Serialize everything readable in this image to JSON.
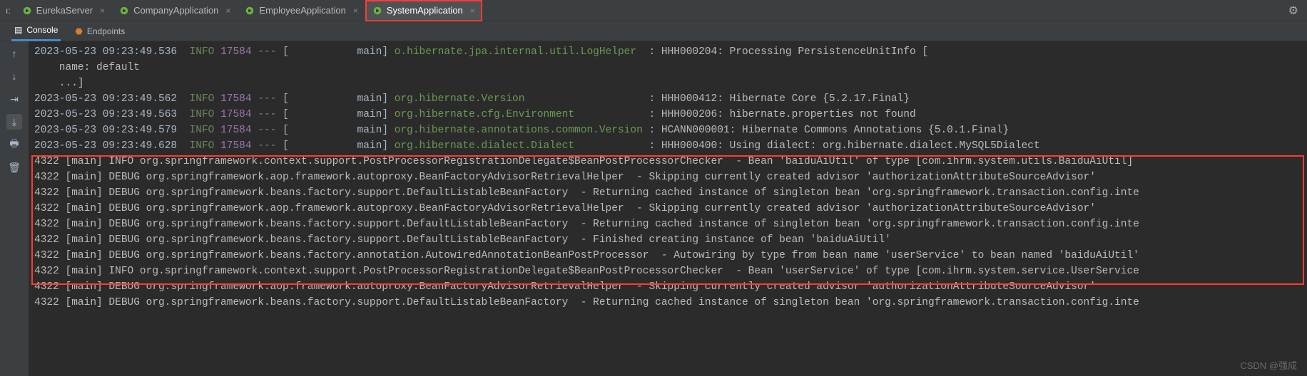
{
  "tabBar": {
    "leftLabel": "ı:",
    "tabs": [
      {
        "label": "EurekaServer",
        "active": false,
        "highlighted": false
      },
      {
        "label": "CompanyApplication",
        "active": false,
        "highlighted": false
      },
      {
        "label": "EmployeeApplication",
        "active": false,
        "highlighted": false
      },
      {
        "label": "SystemApplication",
        "active": true,
        "highlighted": true
      }
    ]
  },
  "toolTabs": {
    "items": [
      {
        "icon": "console-icon",
        "label": "Console",
        "active": true
      },
      {
        "icon": "endpoints-icon",
        "label": "Endpoints",
        "active": false
      }
    ]
  },
  "gutter": {
    "buttons": [
      {
        "name": "arrow-up-icon",
        "glyph": "↑"
      },
      {
        "name": "arrow-down-icon",
        "glyph": "↓"
      },
      {
        "name": "soft-wrap-icon",
        "glyph": "⇥"
      },
      {
        "name": "scroll-to-end-icon",
        "glyph": "⤓",
        "active": true
      },
      {
        "name": "print-icon",
        "glyph": "🖶"
      },
      {
        "name": "trash-icon",
        "glyph": "🗑"
      }
    ]
  },
  "topLog": [
    {
      "ts": "2023-05-23 09:23:49.536",
      "lvl": "INFO",
      "pid": "17584",
      "thread": "main",
      "logger": "o.hibernate.jpa.internal.util.LogHelper",
      "msg": "HHH000204: Processing PersistenceUnitInfo ["
    },
    {
      "cont": "    name: default"
    },
    {
      "cont": "    ...]"
    },
    {
      "ts": "2023-05-23 09:23:49.562",
      "lvl": "INFO",
      "pid": "17584",
      "thread": "main",
      "logger": "org.hibernate.Version",
      "msg": "HHH000412: Hibernate Core {5.2.17.Final}"
    },
    {
      "ts": "2023-05-23 09:23:49.563",
      "lvl": "INFO",
      "pid": "17584",
      "thread": "main",
      "logger": "org.hibernate.cfg.Environment",
      "msg": "HHH000206: hibernate.properties not found"
    },
    {
      "ts": "2023-05-23 09:23:49.579",
      "lvl": "INFO",
      "pid": "17584",
      "thread": "main",
      "logger": "org.hibernate.annotations.common.Version",
      "msg": "HCANN000001: Hibernate Commons Annotations {5.0.1.Final}"
    },
    {
      "ts": "2023-05-23 09:23:49.628",
      "lvl": "INFO",
      "pid": "17584",
      "thread": "main",
      "logger": "org.hibernate.dialect.Dialect",
      "msg": "HHH000400: Using dialect: org.hibernate.dialect.MySQL5Dialect"
    }
  ],
  "bottomLog": [
    "4322 [main] INFO org.springframework.context.support.PostProcessorRegistrationDelegate$BeanPostProcessorChecker  - Bean 'baiduAiUtil' of type [com.ihrm.system.utils.BaiduAiUtil]",
    "4322 [main] DEBUG org.springframework.aop.framework.autoproxy.BeanFactoryAdvisorRetrievalHelper  - Skipping currently created advisor 'authorizationAttributeSourceAdvisor'",
    "4322 [main] DEBUG org.springframework.beans.factory.support.DefaultListableBeanFactory  - Returning cached instance of singleton bean 'org.springframework.transaction.config.inte",
    "4322 [main] DEBUG org.springframework.aop.framework.autoproxy.BeanFactoryAdvisorRetrievalHelper  - Skipping currently created advisor 'authorizationAttributeSourceAdvisor'",
    "4322 [main] DEBUG org.springframework.beans.factory.support.DefaultListableBeanFactory  - Returning cached instance of singleton bean 'org.springframework.transaction.config.inte",
    "4322 [main] DEBUG org.springframework.beans.factory.support.DefaultListableBeanFactory  - Finished creating instance of bean 'baiduAiUtil'",
    "4322 [main] DEBUG org.springframework.beans.factory.annotation.AutowiredAnnotationBeanPostProcessor  - Autowiring by type from bean name 'userService' to bean named 'baiduAiUtil'",
    "4322 [main] INFO org.springframework.context.support.PostProcessorRegistrationDelegate$BeanPostProcessorChecker  - Bean 'userService' of type [com.ihrm.system.service.UserService",
    "4322 [main] DEBUG org.springframework.aop.framework.autoproxy.BeanFactoryAdvisorRetrievalHelper  - Skipping currently created advisor 'authorizationAttributeSourceAdvisor'",
    "4322 [main] DEBUG org.springframework.beans.factory.support.DefaultListableBeanFactory  - Returning cached instance of singleton bean 'org.springframework.transaction.config.inte"
  ],
  "watermark": "CSDN @强成"
}
